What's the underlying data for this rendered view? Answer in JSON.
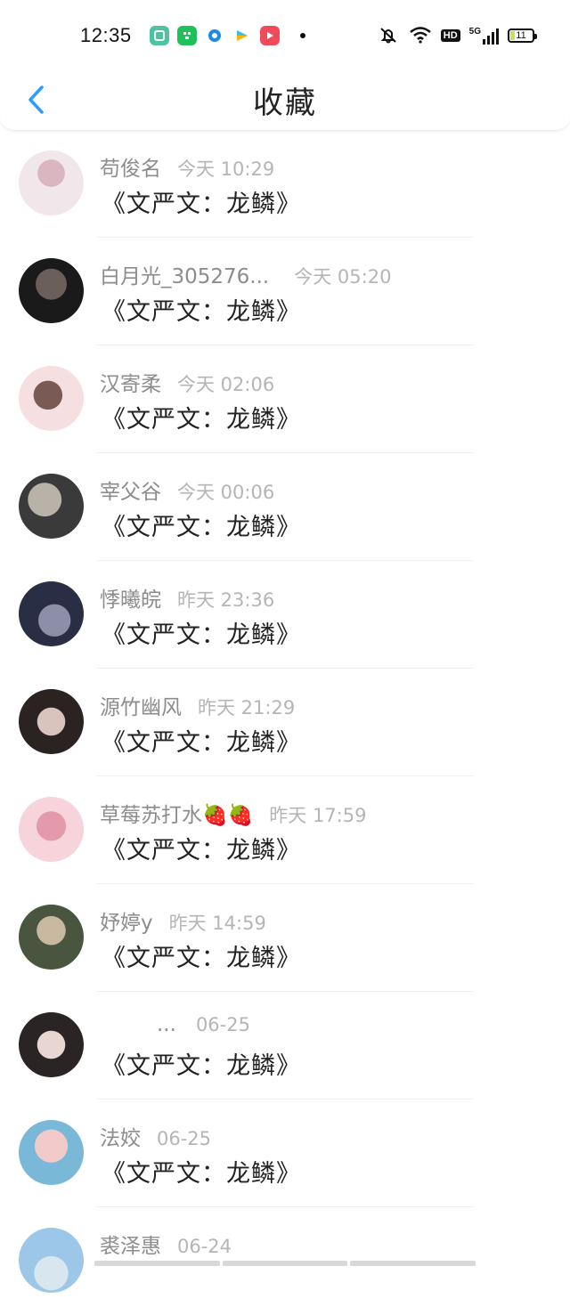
{
  "status": {
    "time": "12:35",
    "app_icons": [
      {
        "name": "gallery-app-icon",
        "color": "#4fc3a1"
      },
      {
        "name": "wechat-mini-app-icon",
        "color": "#21c05a"
      },
      {
        "name": "browser-app-icon",
        "color": "#1e88e5"
      },
      {
        "name": "video-app-icon",
        "color": "#3cc0e0"
      },
      {
        "name": "player-app-icon",
        "color": "#ef4b5a"
      }
    ],
    "hd": "HD",
    "network": "5G",
    "battery": "11"
  },
  "header": {
    "title": "收藏",
    "back_icon": "chevron-left-icon",
    "accent": "#2f9bff"
  },
  "items": [
    {
      "name": "苟俊名",
      "time": "今天 10:29",
      "content": "《文严文：龙鳞》",
      "avatar_colors": [
        "#f1e6ea",
        "#d9b6c0"
      ]
    },
    {
      "name": "白月光_305276...",
      "time": "今天 05:20",
      "content": "《文严文：龙鳞》",
      "avatar_colors": [
        "#1a1a1a",
        "#6b5f5a"
      ]
    },
    {
      "name": "汉寄柔",
      "time": "今天 02:06",
      "content": "《文严文：龙鳞》",
      "avatar_colors": [
        "#f5dfe0",
        "#7a5a55"
      ]
    },
    {
      "name": "宰父谷",
      "time": "今天 00:06",
      "content": "《文严文：龙鳞》",
      "avatar_colors": [
        "#3a3a3a",
        "#b8b2a8"
      ]
    },
    {
      "name": "悸曦皖",
      "time": "昨天 23:36",
      "content": "《文严文：龙鳞》",
      "avatar_colors": [
        "#2a2e45",
        "#8d8fa8"
      ]
    },
    {
      "name": "源竹幽风",
      "time": "昨天 21:29",
      "content": "《文严文：龙鳞》",
      "avatar_colors": [
        "#2b2222",
        "#d8c4bd"
      ]
    },
    {
      "name": "草莓苏打水🍓🍓",
      "time": "昨天 17:59",
      "content": "《文严文：龙鳞》",
      "avatar_colors": [
        "#f7d3dc",
        "#e59aab"
      ]
    },
    {
      "name": "妤婷y",
      "time": "昨天 14:59",
      "content": "《文严文：龙鳞》",
      "avatar_colors": [
        "#4a5540",
        "#c9b8a0"
      ]
    },
    {
      "name": "...",
      "time": "06-25",
      "content": "《文严文：龙鳞》",
      "avatar_colors": [
        "#2a2424",
        "#e8d6d2"
      ]
    },
    {
      "name": "法姣",
      "time": "06-25",
      "content": "《文严文：龙鳞》",
      "avatar_colors": [
        "#f2c9c9",
        "#7ab8d8"
      ]
    },
    {
      "name": "裘泽惠",
      "time": "06-24",
      "content": "",
      "avatar_colors": [
        "#9cc7e8",
        "#d8e6ef"
      ]
    }
  ]
}
